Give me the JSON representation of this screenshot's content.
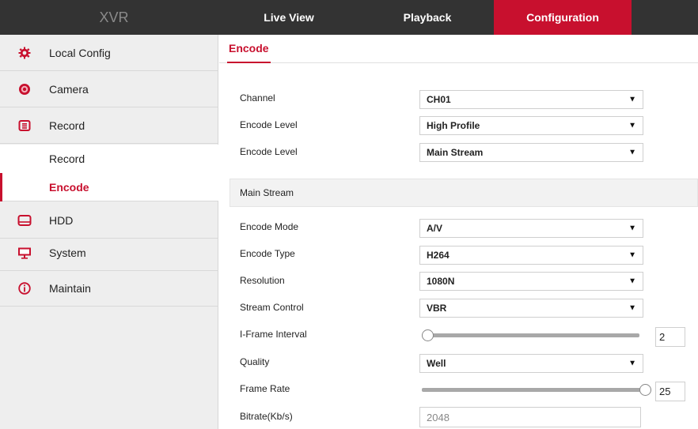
{
  "header": {
    "logo": "XVR",
    "nav": {
      "live_view": "Live View",
      "playback": "Playback",
      "configuration": "Configuration"
    }
  },
  "sidebar": {
    "local_config": "Local Config",
    "camera": "Camera",
    "record": "Record",
    "record_sub": "Record",
    "encode_sub": "Encode",
    "hdd": "HDD",
    "system": "System",
    "maintain": "Maintain"
  },
  "content": {
    "tab": "Encode",
    "fields": {
      "channel_label": "Channel",
      "channel_value": "CH01",
      "encode_level_label": "Encode Level",
      "encode_level_value": "High Profile",
      "encode_level2_label": "Encode Level",
      "encode_level2_value": "Main Stream",
      "section_title": "Main Stream",
      "encode_mode_label": "Encode Mode",
      "encode_mode_value": "A/V",
      "encode_type_label": "Encode Type",
      "encode_type_value": "H264",
      "resolution_label": "Resolution",
      "resolution_value": "1080N",
      "stream_control_label": "Stream Control",
      "stream_control_value": "VBR",
      "iframe_label": "I-Frame Interval",
      "iframe_value": "2",
      "iframe_slider_fraction": 0.0,
      "quality_label": "Quality",
      "quality_value": "Well",
      "frame_rate_label": "Frame Rate",
      "frame_rate_value": "25",
      "frame_rate_slider_fraction": 1.0,
      "bitrate_label": "Bitrate(Kb/s)",
      "bitrate_value": "2048"
    }
  },
  "colors": {
    "accent": "#c8102e",
    "topbar": "#333333",
    "sidebar": "#eeeeee"
  },
  "icons": {
    "local_config": "gear-icon",
    "camera": "camera-icon",
    "record": "record-icon",
    "hdd": "hdd-icon",
    "system": "monitor-icon",
    "maintain": "info-icon"
  }
}
